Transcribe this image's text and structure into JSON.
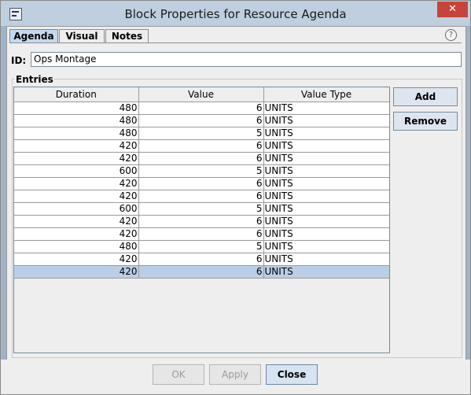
{
  "window": {
    "title": "Block Properties for Resource Agenda",
    "close_symbol": "✕"
  },
  "tabs": [
    {
      "label": "Agenda"
    },
    {
      "label": "Visual"
    },
    {
      "label": "Notes"
    }
  ],
  "help": {
    "symbol": "?"
  },
  "form": {
    "id_label": "ID:",
    "id_value": "Ops Montage",
    "entries_label": "Entries"
  },
  "table": {
    "columns": [
      "Duration",
      "Value",
      "Value Type"
    ],
    "rows": [
      [
        "480",
        "6",
        "UNITS"
      ],
      [
        "480",
        "6",
        "UNITS"
      ],
      [
        "480",
        "5",
        "UNITS"
      ],
      [
        "420",
        "6",
        "UNITS"
      ],
      [
        "420",
        "6",
        "UNITS"
      ],
      [
        "600",
        "5",
        "UNITS"
      ],
      [
        "420",
        "6",
        "UNITS"
      ],
      [
        "420",
        "6",
        "UNITS"
      ],
      [
        "600",
        "5",
        "UNITS"
      ],
      [
        "420",
        "6",
        "UNITS"
      ],
      [
        "420",
        "6",
        "UNITS"
      ],
      [
        "480",
        "5",
        "UNITS"
      ],
      [
        "420",
        "6",
        "UNITS"
      ],
      [
        "420",
        "6",
        "UNITS"
      ]
    ],
    "selected_row": 13
  },
  "side_buttons": {
    "add": "Add",
    "remove": "Remove"
  },
  "footer": {
    "ok": "OK",
    "apply": "Apply",
    "close": "Close"
  }
}
